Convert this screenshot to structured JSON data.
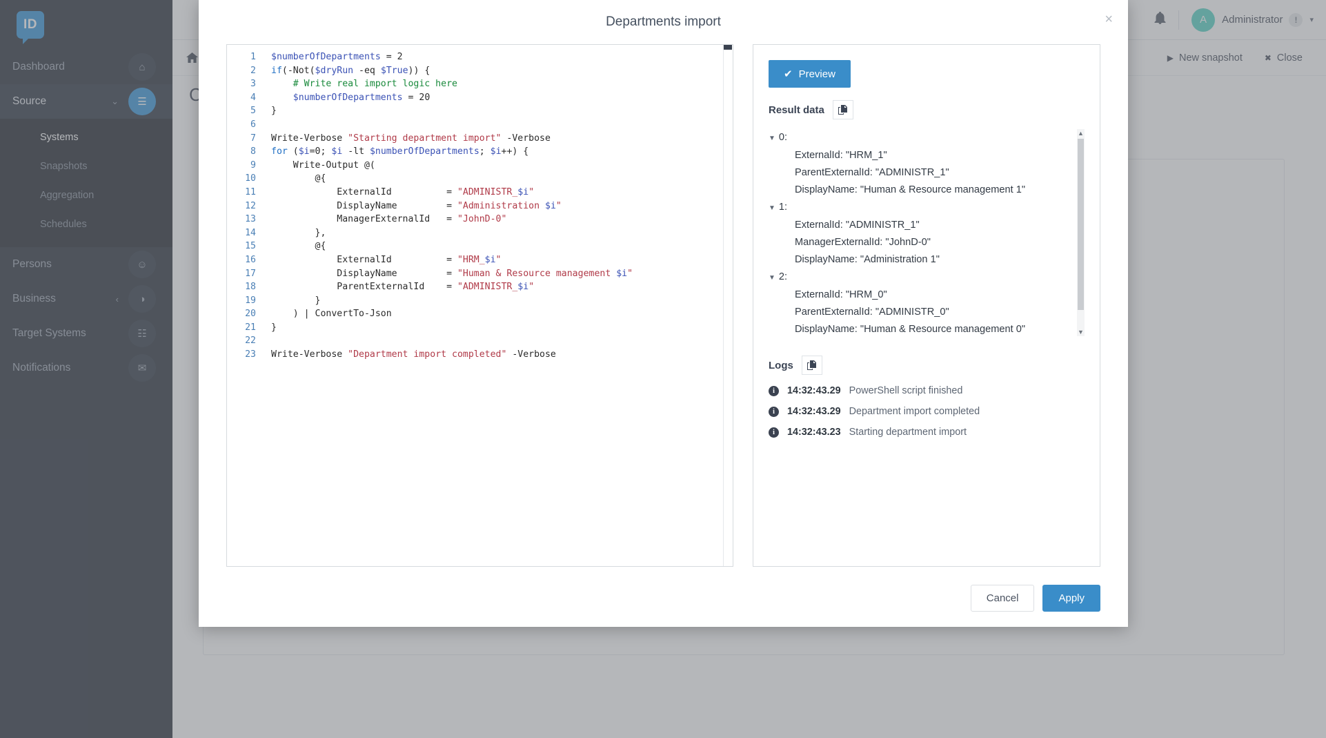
{
  "sidebar": {
    "logo_text": "ID",
    "items": [
      {
        "label": "Dashboard",
        "icon": "home-icon",
        "glyph": "⌂",
        "active": false
      },
      {
        "label": "Source",
        "icon": "database-icon",
        "glyph": "☰",
        "active": true,
        "caret": "⌄"
      },
      {
        "label": "Persons",
        "icon": "people-icon",
        "glyph": "☺",
        "active": false
      },
      {
        "label": "Business",
        "icon": "briefcase-icon",
        "glyph": "◑",
        "active": false,
        "caret": "‹"
      },
      {
        "label": "Target Systems",
        "icon": "grid-icon",
        "glyph": "☷",
        "active": false
      },
      {
        "label": "Notifications",
        "icon": "mail-icon",
        "glyph": "✉",
        "active": false
      }
    ],
    "subitems": [
      {
        "label": "Systems",
        "active": true
      },
      {
        "label": "Snapshots",
        "active": false
      },
      {
        "label": "Aggregation",
        "active": false
      },
      {
        "label": "Schedules",
        "active": false
      }
    ]
  },
  "topbar": {
    "bell_icon": "bell-icon",
    "bell_glyph": "ὑ4",
    "user_initial": "A",
    "user_name": "Administrator",
    "user_warning": "!",
    "caret": "▾"
  },
  "subbar": {
    "home_glyph": "⌂",
    "new_snapshot_label": "New snapshot",
    "new_snapshot_glyph": "▶",
    "close_label": "Close",
    "close_glyph": "✖"
  },
  "background_page": {
    "title": "Co",
    "line1": "(",
    "line2": "(",
    "line3": "/",
    "line4": "|"
  },
  "modal": {
    "title": "Departments import",
    "close_glyph": "×",
    "cancel_label": "Cancel",
    "apply_label": "Apply"
  },
  "editor": {
    "language": "powershell",
    "lines": [
      {
        "no": "1",
        "tokens": [
          {
            "t": "$numberOfDepartments",
            "c": "v"
          },
          {
            "t": " = ",
            "c": "n"
          },
          {
            "t": "2",
            "c": "n"
          }
        ]
      },
      {
        "no": "2",
        "tokens": [
          {
            "t": "if",
            "c": "k"
          },
          {
            "t": "(-Not(",
            "c": "n"
          },
          {
            "t": "$dryRun",
            "c": "v"
          },
          {
            "t": " -eq ",
            "c": "n"
          },
          {
            "t": "$True",
            "c": "v"
          },
          {
            "t": ")) {",
            "c": "n"
          }
        ]
      },
      {
        "no": "3",
        "tokens": [
          {
            "t": "    # Write real import logic here",
            "c": "c"
          }
        ]
      },
      {
        "no": "4",
        "tokens": [
          {
            "t": "    ",
            "c": "n"
          },
          {
            "t": "$numberOfDepartments",
            "c": "v"
          },
          {
            "t": " = ",
            "c": "n"
          },
          {
            "t": "20",
            "c": "n"
          }
        ]
      },
      {
        "no": "5",
        "tokens": [
          {
            "t": "}",
            "c": "n"
          }
        ]
      },
      {
        "no": "6",
        "tokens": [
          {
            "t": "",
            "c": "n"
          }
        ]
      },
      {
        "no": "7",
        "tokens": [
          {
            "t": "Write-Verbose ",
            "c": "n"
          },
          {
            "t": "\"Starting department import\"",
            "c": "s"
          },
          {
            "t": " -Verbose",
            "c": "n"
          }
        ]
      },
      {
        "no": "8",
        "tokens": [
          {
            "t": "for",
            "c": "k"
          },
          {
            "t": " (",
            "c": "n"
          },
          {
            "t": "$i",
            "c": "v"
          },
          {
            "t": "=0; ",
            "c": "n"
          },
          {
            "t": "$i",
            "c": "v"
          },
          {
            "t": " -lt ",
            "c": "n"
          },
          {
            "t": "$numberOfDepartments",
            "c": "v"
          },
          {
            "t": "; ",
            "c": "n"
          },
          {
            "t": "$i",
            "c": "v"
          },
          {
            "t": "++) {",
            "c": "n"
          }
        ]
      },
      {
        "no": "9",
        "tokens": [
          {
            "t": "    Write-Output @(",
            "c": "n"
          }
        ]
      },
      {
        "no": "10",
        "tokens": [
          {
            "t": "        @{",
            "c": "n"
          }
        ]
      },
      {
        "no": "11",
        "tokens": [
          {
            "t": "            ExternalId          = ",
            "c": "n"
          },
          {
            "t": "\"ADMINISTR_",
            "c": "s"
          },
          {
            "t": "$i",
            "c": "v"
          },
          {
            "t": "\"",
            "c": "s"
          }
        ]
      },
      {
        "no": "12",
        "tokens": [
          {
            "t": "            DisplayName         = ",
            "c": "n"
          },
          {
            "t": "\"Administration ",
            "c": "s"
          },
          {
            "t": "$i",
            "c": "v"
          },
          {
            "t": "\"",
            "c": "s"
          }
        ]
      },
      {
        "no": "13",
        "tokens": [
          {
            "t": "            ManagerExternalId   = ",
            "c": "n"
          },
          {
            "t": "\"JohnD-0\"",
            "c": "s"
          }
        ]
      },
      {
        "no": "14",
        "tokens": [
          {
            "t": "        },",
            "c": "n"
          }
        ]
      },
      {
        "no": "15",
        "tokens": [
          {
            "t": "        @{",
            "c": "n"
          }
        ]
      },
      {
        "no": "16",
        "tokens": [
          {
            "t": "            ExternalId          = ",
            "c": "n"
          },
          {
            "t": "\"HRM_",
            "c": "s"
          },
          {
            "t": "$i",
            "c": "v"
          },
          {
            "t": "\"",
            "c": "s"
          }
        ]
      },
      {
        "no": "17",
        "tokens": [
          {
            "t": "            DisplayName         = ",
            "c": "n"
          },
          {
            "t": "\"Human & Resource management ",
            "c": "s"
          },
          {
            "t": "$i",
            "c": "v"
          },
          {
            "t": "\"",
            "c": "s"
          }
        ]
      },
      {
        "no": "18",
        "tokens": [
          {
            "t": "            ParentExternalId    = ",
            "c": "n"
          },
          {
            "t": "\"ADMINISTR_",
            "c": "s"
          },
          {
            "t": "$i",
            "c": "v"
          },
          {
            "t": "\"",
            "c": "s"
          }
        ]
      },
      {
        "no": "19",
        "tokens": [
          {
            "t": "        }",
            "c": "n"
          }
        ]
      },
      {
        "no": "20",
        "tokens": [
          {
            "t": "    ) | ConvertTo-Json",
            "c": "n"
          }
        ]
      },
      {
        "no": "21",
        "tokens": [
          {
            "t": "}",
            "c": "n"
          }
        ]
      },
      {
        "no": "22",
        "tokens": [
          {
            "t": "",
            "c": "n"
          }
        ]
      },
      {
        "no": "23",
        "tokens": [
          {
            "t": "Write-Verbose ",
            "c": "n"
          },
          {
            "t": "\"Department import completed\"",
            "c": "s"
          },
          {
            "t": " -Verbose",
            "c": "n"
          }
        ]
      }
    ]
  },
  "panel": {
    "preview_label": "Preview",
    "preview_glyph": "✔",
    "result_title": "Result data",
    "logs_title": "Logs",
    "copy_glyph": "❐",
    "result_entries": [
      {
        "index": "0:",
        "props": [
          "ExternalId: \"HRM_1\"",
          "ParentExternalId: \"ADMINISTR_1\"",
          "DisplayName: \"Human & Resource management 1\""
        ]
      },
      {
        "index": "1:",
        "props": [
          "ExternalId: \"ADMINISTR_1\"",
          "ManagerExternalId: \"JohnD-0\"",
          "DisplayName: \"Administration 1\""
        ]
      },
      {
        "index": "2:",
        "props": [
          "ExternalId: \"HRM_0\"",
          "ParentExternalId: \"ADMINISTR_0\"",
          "DisplayName: \"Human & Resource management 0\""
        ]
      }
    ],
    "logs": [
      {
        "time": "14:32:43.29",
        "message": "PowerShell script finished"
      },
      {
        "time": "14:32:43.29",
        "message": "Department import completed"
      },
      {
        "time": "14:32:43.23",
        "message": "Starting department import"
      }
    ]
  },
  "colors": {
    "accent": "#3a8dc9",
    "sidebar_bg": "#1d2430",
    "avatar": "#4dd0c0",
    "string": "#b03a48",
    "comment": "#1a8a3c",
    "keyword": "#1f6fc4"
  }
}
